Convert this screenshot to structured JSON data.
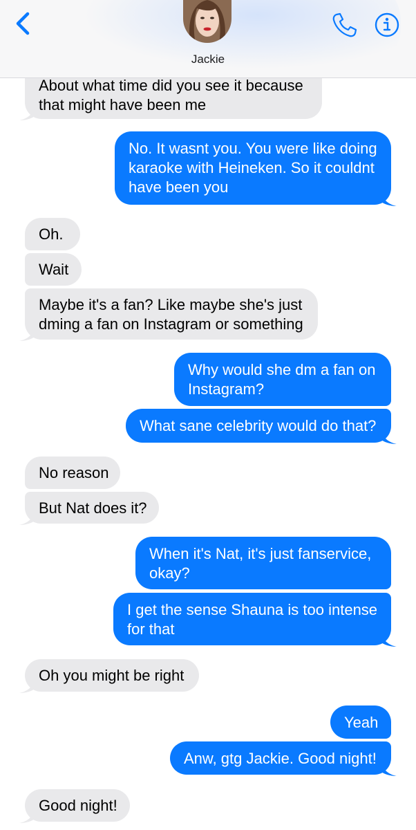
{
  "header": {
    "contact_name": "Jackie",
    "back_icon": "chevron-left-icon",
    "call_icon": "phone-icon",
    "details_icon": "info-icon",
    "accent_color": "#0a7aff"
  },
  "colors": {
    "incoming_bubble": "#e9e9eb",
    "outgoing_bubble": "#0a7aff"
  },
  "messages": [
    {
      "dir": "in",
      "lines": [
        "About what time did you see it because",
        "that might have been me"
      ]
    },
    {
      "dir": "out",
      "lines": [
        "No. It wasnt you. You were like doing",
        "karaoke with Heineken. So it couldnt",
        "have been you"
      ]
    },
    {
      "dir": "in",
      "lines": [
        "Oh."
      ]
    },
    {
      "dir": "in",
      "lines": [
        "Wait"
      ]
    },
    {
      "dir": "in",
      "lines": [
        "Maybe it's a fan? Like maybe she's just",
        "dming a fan on Instagram or something"
      ]
    },
    {
      "dir": "out",
      "lines": [
        "Why would she dm a fan on",
        "Instagram?"
      ]
    },
    {
      "dir": "out",
      "lines": [
        "What sane celebrity would do that?"
      ]
    },
    {
      "dir": "in",
      "lines": [
        "No reason"
      ]
    },
    {
      "dir": "in",
      "lines": [
        "But Nat does it?"
      ]
    },
    {
      "dir": "out",
      "lines": [
        "When it's Nat, it's just fanservice,",
        "okay?"
      ]
    },
    {
      "dir": "out",
      "lines": [
        "I get the sense Shauna is too intense",
        "for that"
      ]
    },
    {
      "dir": "in",
      "lines": [
        "Oh you might be right"
      ]
    },
    {
      "dir": "out",
      "lines": [
        "Yeah"
      ]
    },
    {
      "dir": "out",
      "lines": [
        "Anw, gtg Jackie. Good night!"
      ]
    },
    {
      "dir": "in",
      "lines": [
        "Good night!"
      ]
    }
  ]
}
